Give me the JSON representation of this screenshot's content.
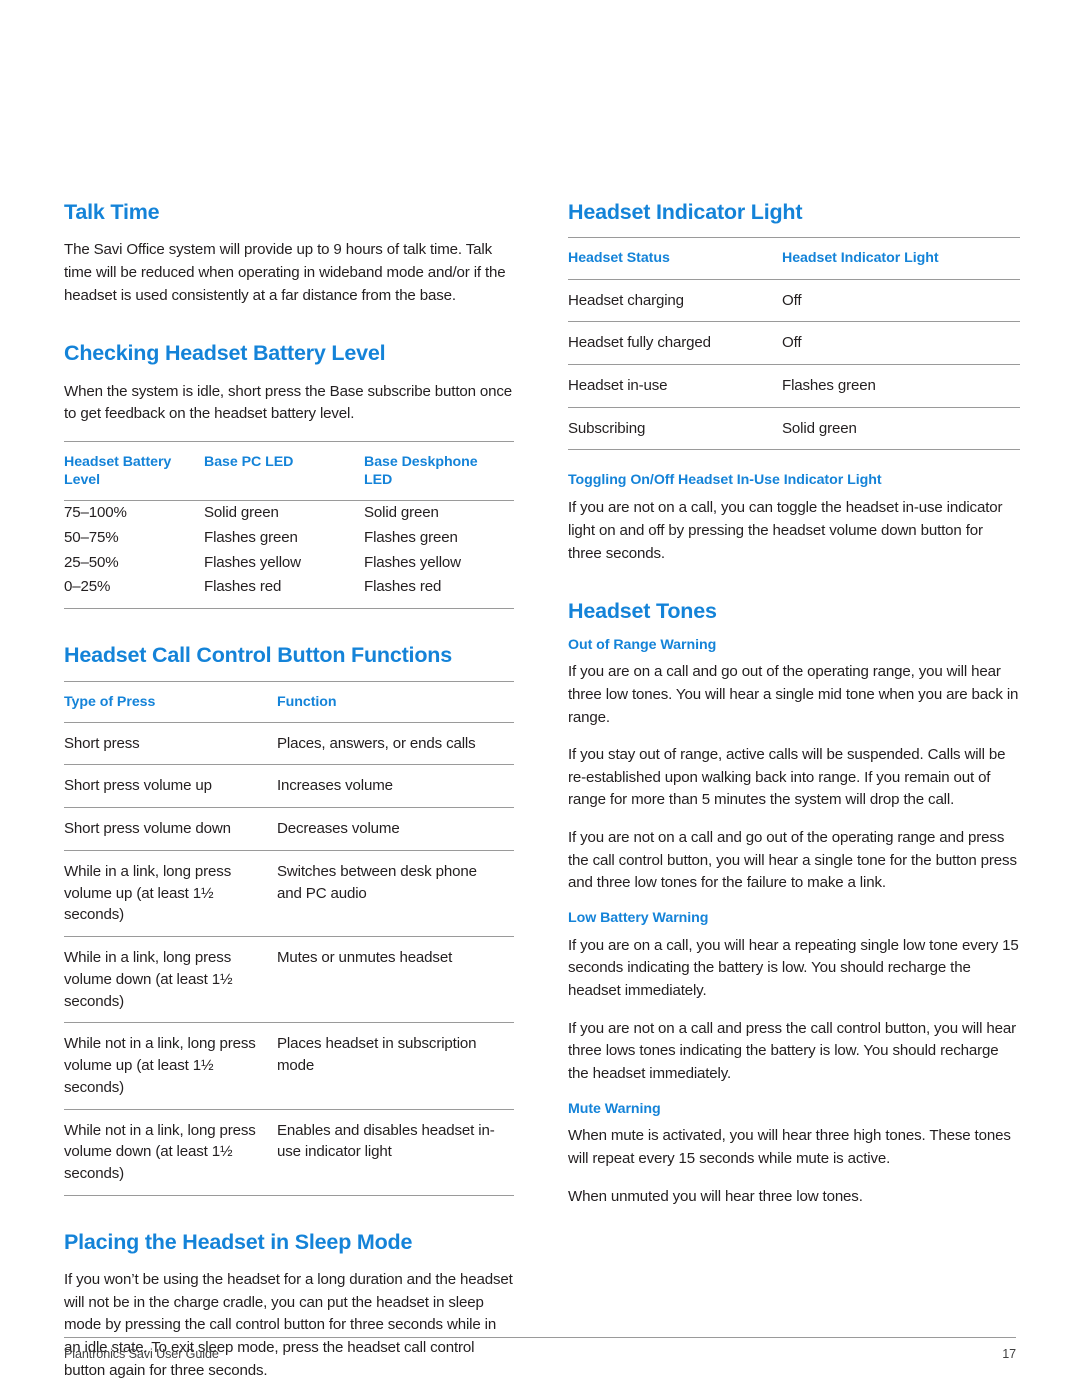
{
  "document": {
    "footer_left": "Plantronics Savi User Guide",
    "footer_page": "17"
  },
  "theme": {
    "accent_blue": "#1483d8",
    "body_text": "#231f20",
    "rule_gray": "#9a9a9a"
  },
  "left_column": {
    "talk_time": {
      "heading": "Talk Time",
      "paragraph": "The Savi Office system will provide up to 9 hours of talk time. Talk time will be reduced when operating in wideband mode and/or if the headset is used consistently at a far distance from the base."
    },
    "battery_level": {
      "heading": "Checking Headset Battery Level",
      "paragraph": "When the system is idle, short press the Base subscribe button once to get feedback on the headset battery level.",
      "table": {
        "columns": [
          "Headset Battery Level",
          "Base PC LED",
          "Base Deskphone LED"
        ],
        "rows": [
          [
            "75–100%",
            "Solid green",
            "Solid green"
          ],
          [
            "50–75%",
            "Flashes green",
            "Flashes green"
          ],
          [
            "25–50%",
            "Flashes yellow",
            "Flashes yellow"
          ],
          [
            "0–25%",
            "Flashes red",
            "Flashes red"
          ]
        ]
      }
    },
    "call_control": {
      "heading": "Headset Call Control Button Functions",
      "table": {
        "columns": [
          "Type of Press",
          "Function"
        ],
        "rows": [
          [
            "Short press",
            "Places, answers, or ends calls"
          ],
          [
            "Short press volume up",
            "Increases volume"
          ],
          [
            "Short press volume down",
            "Decreases volume"
          ],
          [
            "While in a link, long press volume up (at least 1½ seconds)",
            "Switches between desk phone and PC audio"
          ],
          [
            "While in a link, long press volume down (at least 1½ seconds)",
            "Mutes or unmutes headset"
          ],
          [
            "While not in a link, long press volume up (at least 1½ seconds)",
            "Places headset in subscription mode"
          ],
          [
            "While not in a link, long press volume down (at least 1½ seconds)",
            "Enables and disables headset in-use indicator light"
          ]
        ]
      }
    },
    "sleep_mode": {
      "heading": "Placing the Headset in Sleep Mode",
      "paragraph": "If you won’t be using the headset for a long duration and the headset will not be in the charge cradle, you can put the headset in sleep mode by pressing the call control button for three seconds while in an idle state. To exit sleep mode, press the headset call control button again for three seconds."
    }
  },
  "right_column": {
    "indicator_light": {
      "heading": "Headset Indicator Light",
      "table": {
        "columns": [
          "Headset Status",
          "Headset Indicator Light"
        ],
        "rows": [
          [
            "Headset charging",
            "Off"
          ],
          [
            "Headset fully charged",
            "Off"
          ],
          [
            "Headset in-use",
            "Flashes green"
          ],
          [
            "Subscribing",
            "Solid green"
          ]
        ]
      }
    },
    "toggling": {
      "heading": "Toggling On/Off Headset In-Use Indicator Light",
      "paragraph": "If you are not on a call, you can toggle the headset in-use indicator light on and off by pressing the headset volume down button for three seconds."
    },
    "headset_tones": {
      "heading": "Headset Tones",
      "out_of_range": {
        "heading": "Out of Range Warning",
        "paragraphs": [
          "If you are on a call and go out of the operating range, you will hear three low tones. You will hear a single mid tone when you are back in range.",
          "If you stay out of range, active calls will be suspended. Calls will be re-established upon walking back into range. If you remain out of range for more than 5 minutes the system will drop the call.",
          "If you are not on a call and go out of the operating range and press the call control button, you will hear a single tone for the button press and three low tones for the failure to make a link."
        ]
      },
      "low_battery": {
        "heading": "Low Battery Warning",
        "paragraphs": [
          "If you are on a call, you will hear a repeating single low tone every 15 seconds indicating the battery is low. You should recharge the headset immediately.",
          "If you are not on a call and press the call control button, you will hear three lows tones indicating the battery is low. You should recharge the headset immediately."
        ]
      },
      "mute": {
        "heading": "Mute Warning",
        "paragraphs": [
          "When mute is activated, you will hear three high tones. These tones will repeat every 15 seconds while mute is active.",
          "When unmuted you will hear three low tones."
        ]
      }
    }
  }
}
